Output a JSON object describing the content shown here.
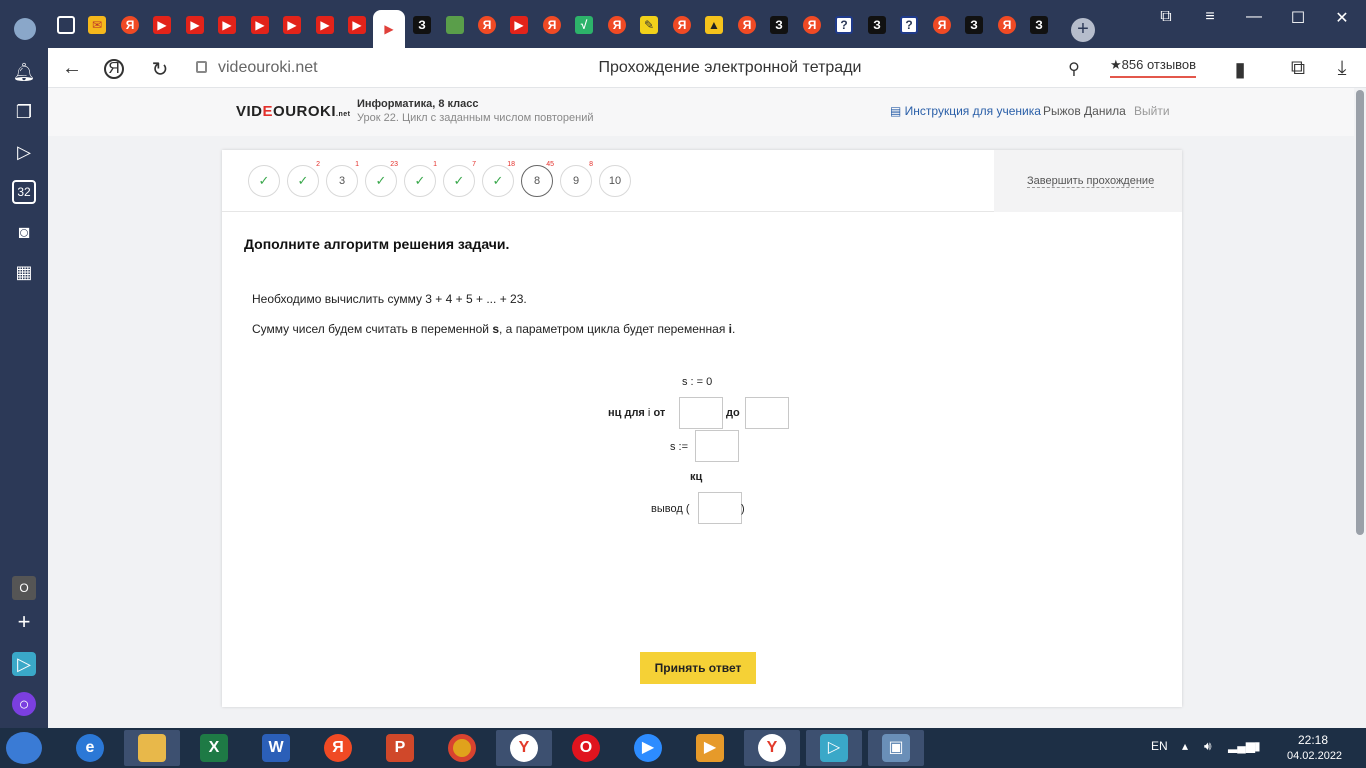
{
  "browser": {
    "tab_icons": [
      "doc-icon",
      "mail-icon",
      "yandex-icon",
      "youtube-icon",
      "youtube-icon",
      "youtube-icon",
      "youtube-icon",
      "youtube-icon",
      "youtube-icon",
      "youtube-icon",
      "video-icon",
      "z-icon",
      "green-icon",
      "yandex-icon",
      "youtube-icon",
      "yandex-icon",
      "vk-icon",
      "yandex-icon",
      "pencil-icon",
      "yandex-icon",
      "image-icon",
      "yandex-icon",
      "z-icon",
      "yandex-icon",
      "question-icon",
      "z-icon",
      "question-icon",
      "yandex-icon",
      "z-icon",
      "yandex-icon",
      "z-icon"
    ],
    "url_host": "videouroki.net",
    "page_title": "Прохождение электронной тетради",
    "reviews": "★856 отзывов"
  },
  "site": {
    "logo_a": "VID",
    "logo_b": "E",
    "logo_c": "OUROKI",
    "logo_d": ".net",
    "course": "Информатика, 8 класс",
    "lesson": "Урок 22. Цикл с заданным числом повторений",
    "instruction_link": "Инструкция для ученика",
    "user_name": "Рыжов Данила",
    "logout": "Выйти"
  },
  "steps": [
    {
      "label": "",
      "done": true,
      "badge": ""
    },
    {
      "label": "",
      "done": true,
      "badge": "2"
    },
    {
      "label": "3",
      "done": false,
      "badge": "1"
    },
    {
      "label": "",
      "done": true,
      "badge": "23"
    },
    {
      "label": "",
      "done": true,
      "badge": "1"
    },
    {
      "label": "",
      "done": true,
      "badge": "7"
    },
    {
      "label": "",
      "done": true,
      "badge": "18"
    },
    {
      "label": "8",
      "done": false,
      "badge": "45",
      "current": true
    },
    {
      "label": "9",
      "done": false,
      "badge": "8"
    },
    {
      "label": "10",
      "done": false,
      "badge": ""
    }
  ],
  "finish_label": "Завершить прохождение",
  "task": {
    "title": "Дополните алгоритм решения задачи.",
    "line1": "Необходимо вычислить сумму 3 + 4 + 5 + ... + 23.",
    "line2_a": "Сумму чисел будем считать в переменной ",
    "line2_b": "s",
    "line2_c": ", а параметром цикла будет переменная ",
    "line2_d": "i",
    "line2_e": ".",
    "algo": {
      "init": "s : = 0",
      "nc": "нц  для",
      "i": "i",
      "ot": "от",
      "do": "до",
      "s_assign": "s :=",
      "kc": "кц",
      "output": "вывод (",
      "close": ")"
    }
  },
  "submit_label": "Принять ответ",
  "taskbar": {
    "lang": "EN",
    "time": "22:18",
    "date": "04.02.2022"
  }
}
